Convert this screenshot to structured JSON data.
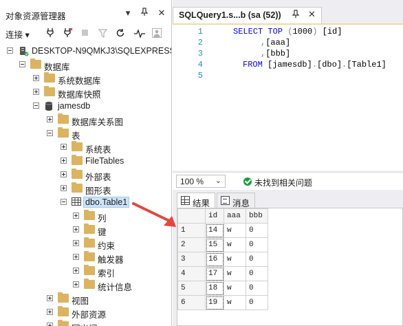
{
  "object_explorer": {
    "title": "对象资源管理器",
    "title_controls": [
      "▾",
      "📌",
      "✕"
    ],
    "toolbar": {
      "connect_label": "连接",
      "connect_arrow": "▾"
    },
    "tree": [
      {
        "id": "server",
        "label": "DESKTOP-N9QMKJ3\\SQLEXPRESS",
        "icon": "server-icon",
        "expander": "minus",
        "level": 0
      },
      {
        "id": "databases",
        "label": "数据库",
        "icon": "folder-icon",
        "expander": "minus",
        "level": 1
      },
      {
        "id": "system-databases",
        "label": "系统数据库",
        "icon": "folder-icon",
        "expander": "plus",
        "level": 2
      },
      {
        "id": "database-snapshots",
        "label": "数据库快照",
        "icon": "folder-icon",
        "expander": "plus",
        "level": 2
      },
      {
        "id": "jamesdb",
        "label": "jamesdb",
        "icon": "database-icon",
        "expander": "minus",
        "level": 2
      },
      {
        "id": "db-diagrams",
        "label": "数据库关系图",
        "icon": "folder-icon",
        "expander": "plus",
        "level": 3
      },
      {
        "id": "tables",
        "label": "表",
        "icon": "folder-icon",
        "expander": "minus",
        "level": 3
      },
      {
        "id": "system-tables",
        "label": "系统表",
        "icon": "folder-icon",
        "expander": "plus",
        "level": 4
      },
      {
        "id": "filetables",
        "label": "FileTables",
        "icon": "folder-icon",
        "expander": "plus",
        "level": 4
      },
      {
        "id": "external-tables",
        "label": "外部表",
        "icon": "folder-icon",
        "expander": "plus",
        "level": 4
      },
      {
        "id": "graph-tables",
        "label": "图形表",
        "icon": "folder-icon",
        "expander": "plus",
        "level": 4
      },
      {
        "id": "dbo-table1",
        "label": "dbo.Table1",
        "icon": "table-icon",
        "expander": "minus",
        "level": 4,
        "selected": true
      },
      {
        "id": "columns",
        "label": "列",
        "icon": "folder-icon",
        "expander": "plus",
        "level": 5
      },
      {
        "id": "keys",
        "label": "键",
        "icon": "folder-icon",
        "expander": "plus",
        "level": 5
      },
      {
        "id": "constraints",
        "label": "约束",
        "icon": "folder-icon",
        "expander": "plus",
        "level": 5
      },
      {
        "id": "triggers",
        "label": "触发器",
        "icon": "folder-icon",
        "expander": "plus",
        "level": 5
      },
      {
        "id": "indexes",
        "label": "索引",
        "icon": "folder-icon",
        "expander": "plus",
        "level": 5
      },
      {
        "id": "statistics",
        "label": "统计信息",
        "icon": "folder-icon",
        "expander": "plus",
        "level": 5
      },
      {
        "id": "views",
        "label": "视图",
        "icon": "folder-icon",
        "expander": "plus",
        "level": 3
      },
      {
        "id": "external-resources",
        "label": "外部资源",
        "icon": "folder-icon",
        "expander": "plus",
        "level": 3
      },
      {
        "id": "synonyms",
        "label": "同义词",
        "icon": "folder-icon",
        "expander": "plus",
        "level": 3
      }
    ]
  },
  "document": {
    "tab_title": "SQLQuery1.s...b (sa (52))",
    "tab_pin": "📌",
    "tab_close": "✕",
    "editor": {
      "line_numbers": [
        "1",
        "2",
        "3",
        "4",
        "5"
      ],
      "lines": [
        {
          "kw1": "SELECT",
          "kw2": "TOP",
          "gy1": " (",
          "tx1": "1000",
          "gy2": ") ",
          "tx2": "[id]"
        },
        {
          "gy1": ",",
          "tx1": "[aaa]"
        },
        {
          "gy1": ",",
          "tx1": "[bbb]"
        },
        {
          "kw1": "FROM",
          "tx1": " [jamesdb]",
          "gy1": ".",
          "tx2": "[dbo]",
          "gy2": ".",
          "tx3": "[Table1]"
        },
        {}
      ]
    },
    "status": {
      "zoom_value": "100 %",
      "zoom_arrow": "⌄",
      "message": "未找到相关问题",
      "ok_color": "#1e9e3a"
    },
    "result_tabs": {
      "results_label": "结果",
      "messages_label": "消息"
    },
    "results_grid": {
      "columns": [
        "id",
        "aaa",
        "bbb"
      ],
      "rows": [
        {
          "n": "1",
          "id": "14",
          "aaa": "w",
          "bbb": "0"
        },
        {
          "n": "2",
          "id": "15",
          "aaa": "w",
          "bbb": "0"
        },
        {
          "n": "3",
          "id": "16",
          "aaa": "w",
          "bbb": "0"
        },
        {
          "n": "4",
          "id": "17",
          "aaa": "w",
          "bbb": "0"
        },
        {
          "n": "5",
          "id": "18",
          "aaa": "w",
          "bbb": "0"
        },
        {
          "n": "6",
          "id": "19",
          "aaa": "w",
          "bbb": "0"
        }
      ]
    }
  },
  "colors": {
    "arrow": "#e8453c",
    "keyword": "#0000ff",
    "line_number": "#2b91af"
  }
}
